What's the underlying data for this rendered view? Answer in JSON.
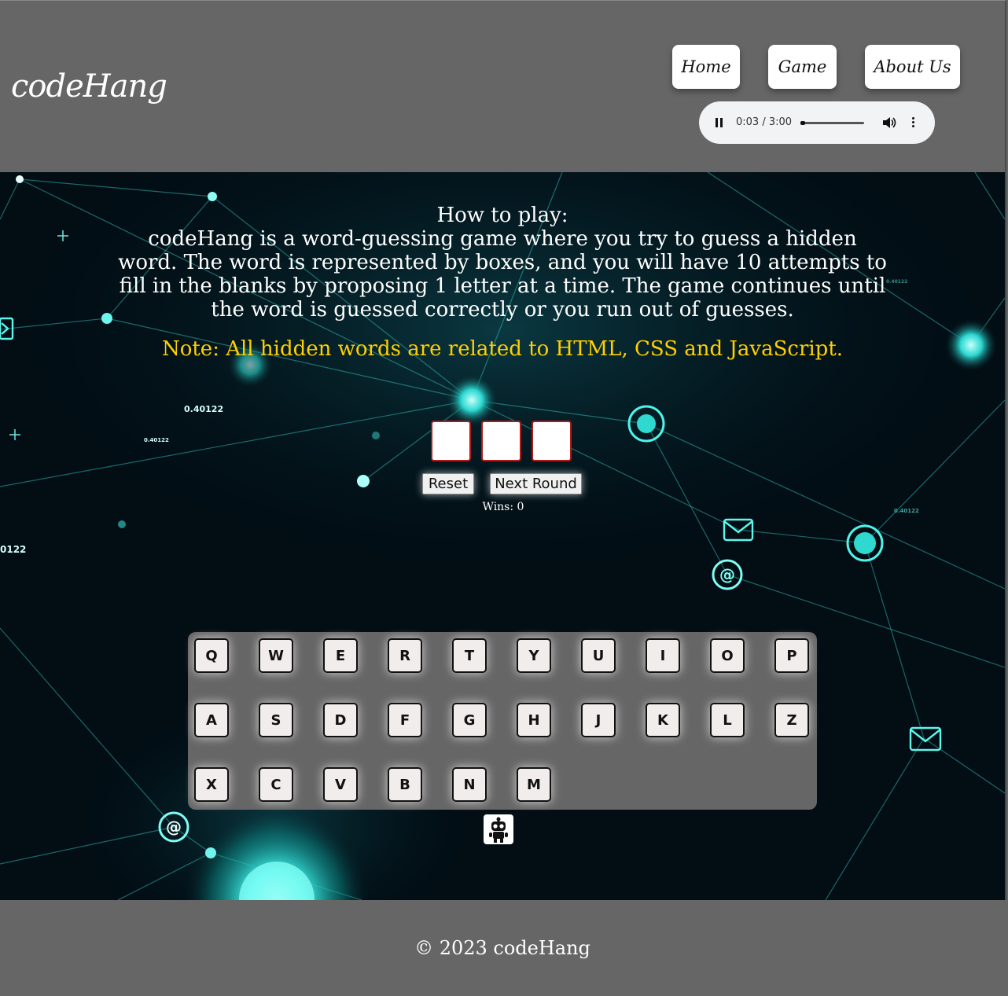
{
  "header": {
    "logo": "codeHang",
    "nav": {
      "home": "Home",
      "game": "Game",
      "about": "About Us"
    },
    "audio": {
      "time": "0:03 / 3:00",
      "progress_fraction": 0.0167,
      "state": "playing"
    }
  },
  "intro": {
    "heading": "How to play:",
    "body": "codeHang is a word-guessing game where you try to guess a hidden word. The word is represented by boxes, and you will have 10 attempts to fill in the blanks by proposing 1 letter at a time. The game continues until the word is guessed correctly or you run out of guesses.",
    "note": "Note: All hidden words are related to HTML, CSS and JavaScript."
  },
  "game": {
    "letter_boxes": [
      "",
      "",
      ""
    ],
    "reset_label": "Reset",
    "next_round_label": "Next Round",
    "wins_text": "Wins: 0"
  },
  "keyboard": {
    "rows": [
      [
        "Q",
        "W",
        "E",
        "R",
        "T",
        "Y",
        "U",
        "I",
        "O",
        "P"
      ],
      [
        "A",
        "S",
        "D",
        "F",
        "G",
        "H",
        "J",
        "K",
        "L",
        "Z"
      ],
      [
        "X",
        "C",
        "V",
        "B",
        "N",
        "M"
      ]
    ]
  },
  "background_labels": [
    "0.40122",
    "0.40122",
    "0122",
    "0.40122",
    "0.40122"
  ],
  "footer": {
    "copyright": "© 2023 codeHang"
  },
  "colors": {
    "chrome": "#666666",
    "note": "#ffd000",
    "box_border": "#b11818",
    "glow": "#3ff0e8"
  }
}
